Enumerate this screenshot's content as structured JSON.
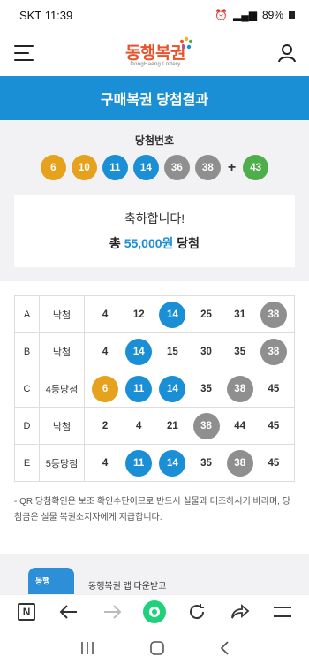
{
  "status_bar": {
    "carrier": "SKT",
    "time": "11:39",
    "battery": "89%"
  },
  "header": {
    "logo_text": "동행복권",
    "logo_sub": "DongHaeng Lottery"
  },
  "page_title": "구매복권 당첨결과",
  "winning": {
    "label": "당첨번호",
    "numbers": [
      "6",
      "10",
      "11",
      "14",
      "36",
      "38"
    ],
    "plus": "+",
    "bonus": "43"
  },
  "result": {
    "congrats": "축하합니다!",
    "prefix": "총",
    "amount": "55,000원",
    "suffix": "당첨"
  },
  "games": [
    {
      "letter": "A",
      "rank": "낙첨",
      "numbers": [
        "4",
        "12",
        "14",
        "25",
        "31",
        "38"
      ]
    },
    {
      "letter": "B",
      "rank": "낙첨",
      "numbers": [
        "4",
        "14",
        "15",
        "30",
        "35",
        "38"
      ]
    },
    {
      "letter": "C",
      "rank": "4등당첨",
      "numbers": [
        "6",
        "11",
        "14",
        "35",
        "38",
        "45"
      ]
    },
    {
      "letter": "D",
      "rank": "낙첨",
      "numbers": [
        "2",
        "4",
        "21",
        "38",
        "44",
        "45"
      ]
    },
    {
      "letter": "E",
      "rank": "5등당첨",
      "numbers": [
        "4",
        "11",
        "14",
        "35",
        "38",
        "45"
      ]
    }
  ],
  "notice": {
    "line1": "- QR 당첨확인은 보조 확인수단이므로 반드시 실물과 대조하시기 바라며, 당",
    "line2": "첨금은 실물 복권소지자에게 지급합니다."
  },
  "promo": {
    "icon_text": "동행",
    "text": "동행복권 앱 다운받고"
  },
  "colors": {
    "brand_blue": "#1a8fd6",
    "ball_yellow": "#e6a21c",
    "ball_blue": "#1a8fd6",
    "ball_gray": "#8f8f8f",
    "ball_green": "#4fae4b",
    "hit_blue": "#1a8fd6",
    "hit_yellow": "#e6a21c",
    "hit_gray": "#8f8f8f"
  },
  "icons": {
    "menu": "hamburger-icon",
    "user": "user-icon",
    "browser": [
      "n-home-icon",
      "back-icon",
      "forward-icon",
      "home-icon",
      "reload-icon",
      "share-icon",
      "menu-icon"
    ],
    "nav": [
      "recents-icon",
      "home-button-icon",
      "back-nav-icon"
    ]
  }
}
